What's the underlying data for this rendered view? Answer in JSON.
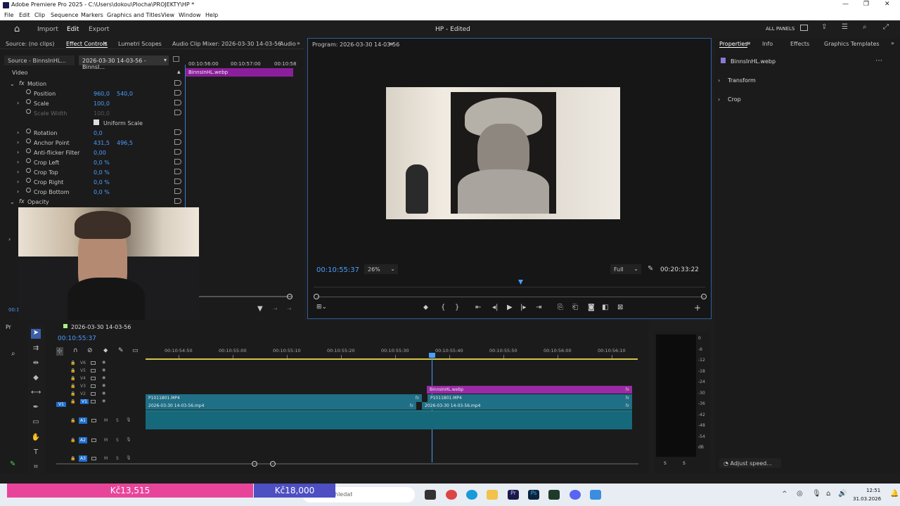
{
  "window": {
    "title": "Adobe Premiere Pro 2025 - C:\\Users\\dokou\\Plocha\\PROJEKTY\\HP *"
  },
  "menu": [
    "File",
    "Edit",
    "Clip",
    "Sequence",
    "Markers",
    "Graphics and Titles",
    "View",
    "Window",
    "Help"
  ],
  "appbar": {
    "import": "Import",
    "edit": "Edit",
    "export": "Export",
    "project": "HP - Edited",
    "all_panels": "ALL PANELS"
  },
  "source_tabs": [
    "Source: (no clips)",
    "Effect Controls",
    "Lumetri Scopes",
    "Audio Clip Mixer: 2026-03-30 14-03-56",
    "Audio"
  ],
  "effect_controls": {
    "source_clip": "Source - BinnsInHL...",
    "sequence_clip": "2026-03-30 14-03-56 - BinnsI...",
    "timecodes": [
      "00:10:56:00",
      "00:10:57:00",
      "00:10:58"
    ],
    "clip_bar": "BinnsInHL.webp",
    "video_label": "Video",
    "motion": "Motion",
    "props": [
      {
        "name": "Position",
        "v1": "960,0",
        "v2": "540,0"
      },
      {
        "name": "Scale",
        "v1": "100,0",
        "v2": ""
      },
      {
        "name": "Scale Width",
        "v1": "100,0",
        "v2": ""
      },
      {
        "name": "Uniform Scale",
        "v1": "",
        "v2": ""
      },
      {
        "name": "Rotation",
        "v1": "0,0",
        "v2": ""
      },
      {
        "name": "Anchor Point",
        "v1": "431,5",
        "v2": "496,5"
      },
      {
        "name": "Anti-flicker Filter",
        "v1": "0,00",
        "v2": ""
      },
      {
        "name": "Crop Left",
        "v1": "0,0 %",
        "v2": ""
      },
      {
        "name": "Crop Top",
        "v1": "0,0 %",
        "v2": ""
      },
      {
        "name": "Crop Right",
        "v1": "0,0 %",
        "v2": ""
      },
      {
        "name": "Crop Bottom",
        "v1": "0,0 %",
        "v2": ""
      }
    ],
    "opacity": "Opacity",
    "bottom_tc": "00:1"
  },
  "program": {
    "title": "Program: 2026-03-30 14-03-56",
    "timecode": "00:10:55:37",
    "zoom": "26%",
    "quality": "Full",
    "duration": "00:20:33:22"
  },
  "properties": {
    "tabs": [
      "Properties",
      "Info",
      "Effects",
      "Graphics Templates"
    ],
    "file": "BinnsInHL.webp",
    "sections": [
      "Transform",
      "Crop"
    ],
    "adjust": "Adjust speed..."
  },
  "timeline": {
    "tab_prefix": "Pr",
    "sequence": "2026-03-30 14-03-56",
    "timecode": "00:10:55:37",
    "ruler": [
      "00:10:54:50",
      "00:10:55:00",
      "00:10:55:10",
      "00:10:55:20",
      "00:10:55:30",
      "00:10:55:40",
      "00:10:55:50",
      "00:10:56:00",
      "00:10:56:10"
    ],
    "video_tracks": [
      "V6",
      "V5",
      "V4",
      "V3",
      "V2",
      "V1"
    ],
    "audio_tracks": [
      "A1",
      "A2",
      "A3"
    ],
    "src_v1": "V1",
    "clips": {
      "webp": "BinnsInHL.webp",
      "mp4_a": "P1011801.MP4",
      "mp4_b": "P1011801.MP4",
      "seq_a": "2026-03-30 14-03-56.mp4",
      "seq_b": "2026-03-30 14-03-56.mp4"
    },
    "fx": "fx",
    "m": "M",
    "s": "S"
  },
  "meter": {
    "scale": [
      "0",
      "-6",
      "-12",
      "-18",
      "-24",
      "-30",
      "-36",
      "-42",
      "-48",
      "-54",
      "dB"
    ],
    "s1": "S",
    "s2": "S"
  },
  "overlay": {
    "pink": "Kč13,515",
    "blue": "Kč18,000"
  },
  "taskbar": {
    "search": "hledat",
    "time": "12:51",
    "date": "31.03.2026"
  }
}
